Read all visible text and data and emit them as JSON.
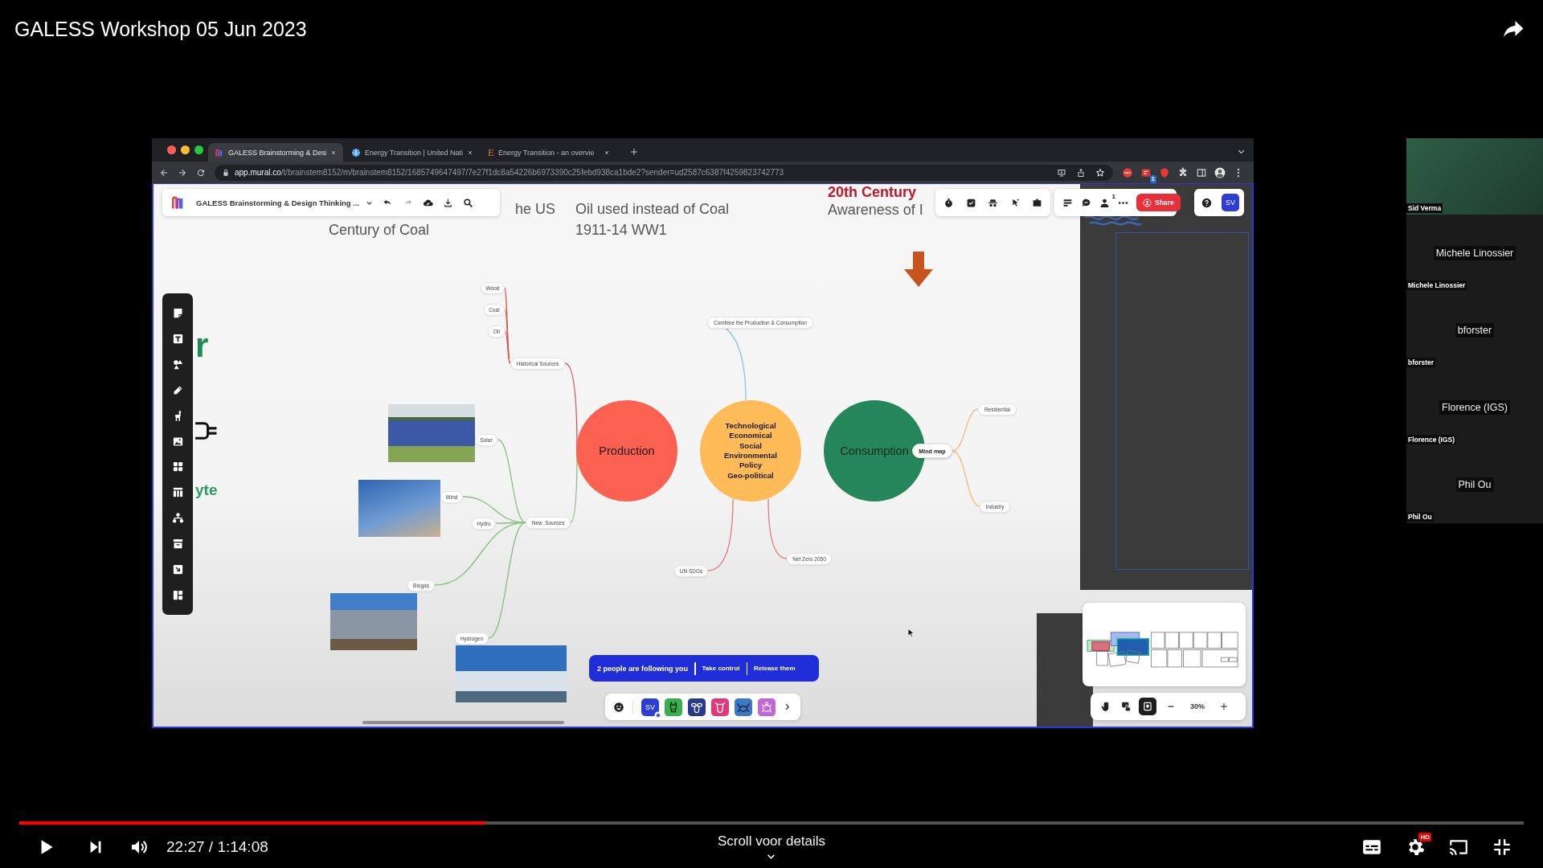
{
  "video_title": "GALESS Workshop 05 Jun 2023",
  "browser": {
    "tabs": [
      {
        "label": "GALESS Brainstorming & Desi",
        "selected": true
      },
      {
        "label": "Energy Transition | United Nati",
        "selected": false
      },
      {
        "label": "Energy Transition - an overvie",
        "glyph": "E",
        "selected": false
      }
    ],
    "url": {
      "host": "app.mural.co",
      "path": "/t/brainstem8152/m/brainstem8152/1685749647497/7e27f1dc8a54226b6973390c25febd938ca1bde2?sender=ud2587c6387f4259823742773"
    },
    "extension_badge": "1"
  },
  "mural": {
    "board_title": "GALESS Brainstorming & Design Thinking ...",
    "member_count": "1",
    "share_label": "Share",
    "user_initials": "SV",
    "canvas_texts": [
      {
        "text": "he US",
        "kind": "note"
      },
      {
        "text": "Century of Coal",
        "kind": "note"
      },
      {
        "text": "Oil used instead of Coal",
        "kind": "note"
      },
      {
        "text": "1911-14 WW1",
        "kind": "note"
      },
      {
        "text": "20th Century",
        "kind": "heading"
      },
      {
        "text": "Awareness of I",
        "kind": "note"
      },
      {
        "text": "r",
        "kind": "display"
      },
      {
        "text": "yte",
        "kind": "accent"
      }
    ],
    "mind_map": [
      {
        "label": "Production",
        "color": "#fa6150",
        "children": [
          {
            "label": "Historical Sources",
            "kind": "topic",
            "children": [
              {
                "label": "Wood",
                "kind": "topic"
              },
              {
                "label": "Coal",
                "kind": "topic"
              },
              {
                "label": "Oil",
                "kind": "topic"
              }
            ]
          },
          {
            "label": "New  Sources",
            "kind": "topic",
            "children": [
              {
                "label": "Solar",
                "kind": "topic"
              },
              {
                "label": "Wind",
                "kind": "topic"
              },
              {
                "label": "Hydro",
                "kind": "topic"
              },
              {
                "label": "Biogas",
                "kind": "topic"
              },
              {
                "label": "Hydrogen",
                "kind": "topic"
              }
            ]
          }
        ]
      },
      {
        "lines": [
          "Technological",
          "Economical",
          "Social",
          "Environmental",
          "Policy",
          "Geo-political"
        ],
        "color": "#ffbb58",
        "children": [
          {
            "label": "Combine the Production & Consumption",
            "kind": "topic"
          },
          {
            "label": "UN SDGs",
            "kind": "topic"
          },
          {
            "label": "Net Zero 2050",
            "kind": "topic"
          }
        ]
      },
      {
        "label": "Consumption",
        "color": "#24865a",
        "children": [
          {
            "label": "Mind map",
            "kind": "tag",
            "children": [
              {
                "label": "Residential",
                "kind": "topic"
              },
              {
                "label": "Industry",
                "kind": "topic"
              }
            ]
          }
        ]
      }
    ],
    "follow_banner": {
      "message": "2 people are following you",
      "actions": [
        "Take control",
        "Release them"
      ]
    },
    "collaborators": [
      {
        "kind": "initials",
        "initials": "SV",
        "color": "#2c3ed6",
        "facilitator": true
      },
      {
        "kind": "animal",
        "color": "#36b14b",
        "facilitator": false
      },
      {
        "kind": "animal",
        "color": "#28398e",
        "facilitator": false
      },
      {
        "kind": "animal",
        "color": "#e2387a",
        "facilitator": false
      },
      {
        "kind": "animal",
        "color": "#3f78c2",
        "facilitator": false
      },
      {
        "kind": "animal",
        "color": "#c465d8",
        "facilitator": false
      }
    ],
    "view_modes": [
      {
        "selected": false
      },
      {
        "selected": false
      },
      {
        "selected": true
      }
    ],
    "zoom_text": "30%"
  },
  "participants": [
    {
      "kind": "video",
      "label": "Sid Verma"
    },
    {
      "kind": "name",
      "center_name": "Michele Linossier",
      "label": "Michele Linossier"
    },
    {
      "kind": "name",
      "center_name": "bforster",
      "label": "bforster"
    },
    {
      "kind": "name",
      "center_name": "Florence (IGS)",
      "label": "Florence (IGS)"
    },
    {
      "kind": "name",
      "center_name": "Phil Ou",
      "label": "Phil Ou"
    }
  ],
  "player": {
    "playing": false,
    "progress": {
      "level": 0.31
    },
    "time": "22:27 / 1:14:08",
    "hint": "Scroll voor details",
    "quality_badge": "HD"
  }
}
